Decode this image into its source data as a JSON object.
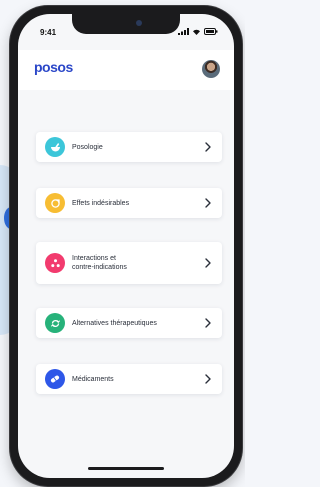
{
  "status_bar": {
    "time": "9:41"
  },
  "header": {
    "logo": "posos"
  },
  "menu": {
    "items": [
      {
        "id": "posologie",
        "label": "Posologie",
        "icon": "pill-mortar-icon",
        "color": "#3cc6d9"
      },
      {
        "id": "effets",
        "label": "Effets indésirables",
        "icon": "warning-arrow-icon",
        "color": "#f7bd33"
      },
      {
        "id": "interactions",
        "label": "Interactions et\ncontre-indications",
        "icon": "dots-icon",
        "color": "#f23b6e"
      },
      {
        "id": "alternatives",
        "label": "Alternatives thérapeutiques",
        "icon": "swap-icon",
        "color": "#27b27a"
      },
      {
        "id": "medicaments",
        "label": "Médicaments",
        "icon": "capsule-icon",
        "color": "#2e57e8"
      }
    ]
  },
  "colors": {
    "brand": "#2b47c8",
    "background": "#f6f7f9",
    "card": "#ffffff"
  }
}
